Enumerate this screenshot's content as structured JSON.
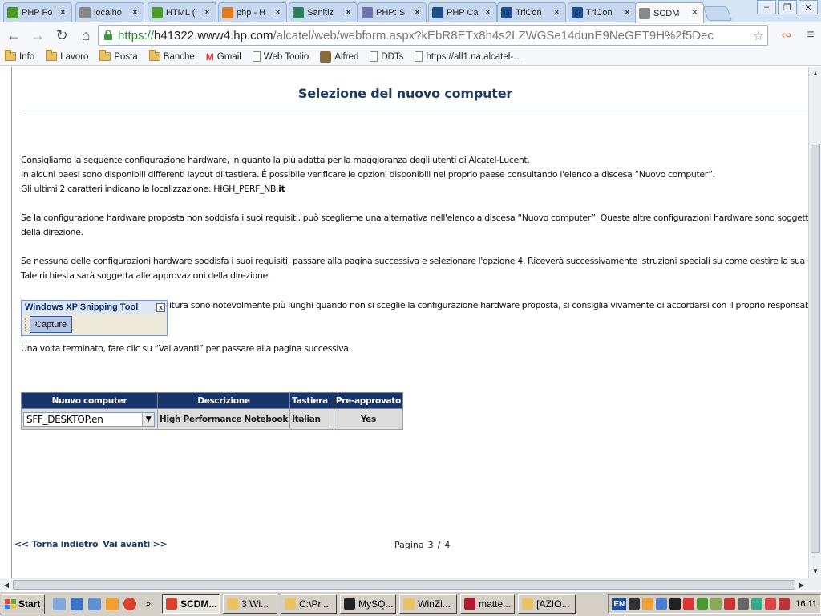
{
  "browser": {
    "tabs": [
      {
        "title": "PHP Fo",
        "favicon": "forum-icon",
        "color": "#4a9a2a",
        "active": false
      },
      {
        "title": "localho",
        "favicon": "page-icon",
        "color": "#888888",
        "active": false
      },
      {
        "title": "HTML (",
        "favicon": "w3-icon",
        "color": "#4a9a2a",
        "active": false
      },
      {
        "title": "php - H",
        "favicon": "stack-icon",
        "color": "#e07b20",
        "active": false
      },
      {
        "title": "Sanitiz",
        "favicon": "plus-icon",
        "color": "#2e7d5b",
        "active": false
      },
      {
        "title": "PHP: S",
        "favicon": "php-icon",
        "color": "#6b73a8",
        "active": false
      },
      {
        "title": "PHP Ca",
        "favicon": "tri-icon",
        "color": "#1e4d8c",
        "active": false
      },
      {
        "title": "TriCon",
        "favicon": "tri-icon",
        "color": "#1e4d8c",
        "active": false
      },
      {
        "title": "TriCon",
        "favicon": "tri-icon",
        "color": "#1e4d8c",
        "active": false
      },
      {
        "title": "SCDM",
        "favicon": "page-icon",
        "color": "#888888",
        "active": true
      }
    ],
    "url": {
      "scheme": "https://",
      "host": "h41322.www4.hp.com",
      "path": "/alcatel/web/webform.aspx?kEbR8ETx8h4s2LZWGSe14dunE9NeGET9H%2f5Dec"
    },
    "bookmarks": [
      {
        "label": "Info",
        "type": "folder"
      },
      {
        "label": "Lavoro",
        "type": "folder"
      },
      {
        "label": "Posta",
        "type": "folder"
      },
      {
        "label": "Banche",
        "type": "folder"
      },
      {
        "label": "Gmail",
        "type": "gmail"
      },
      {
        "label": "Web Toolio",
        "type": "page"
      },
      {
        "label": "Alfred",
        "type": "alfred"
      },
      {
        "label": "DDTs",
        "type": "page"
      },
      {
        "label": "https://all1.na.alcatel-...",
        "type": "page"
      }
    ]
  },
  "page": {
    "title": "Selezione del nuovo computer",
    "para1_line1": "Consigliamo la seguente configurazione hardware, in quanto la più adatta per la maggioranza degli utenti di Alcatel-Lucent.",
    "para1_line2": "In alcuni paesi sono disponibili differenti layout di tastiera. È possibile verificare le opzioni disponibili nel proprio paese consultando l'elenco a discesa “Nuovo computer”.",
    "para1_line3_prefix": "Gli ultimi 2 caratteri indicano la localizzazione: HIGH_PERF_NB.",
    "para1_line3_suffix": "it",
    "para2_line1": "Se la configurazione hardware proposta non soddisfa i suoi requisiti, può sceglierne una alternativa nell'elenco a discesa “Nuovo computer”. Queste altre configurazioni hardware sono soggette alle approvazioni",
    "para2_line2": "della direzione.",
    "para3_line1": "Se nessuna delle configurazioni hardware soddisfa i suoi requisiti, passare alla pagina successiva e selezionare l'opzione 4. Riceverà successivamente istruzioni speciali su come gestire la sua richiesta non standar",
    "para3_line2": "Tale richiesta sarà soggetta alle approvazioni della direzione.",
    "para4_line1": "itura sono notevolmente più lunghi quando non si sceglie la configurazione hardware proposta, si consiglia vivamente di accordarsi con il proprio responsabile prima di inoltr",
    "para5": "Una volta terminato, fare clic su “Vai avanti” per passare alla pagina successiva.",
    "table": {
      "headers": [
        "Nuovo computer",
        "Descrizione",
        "Tastiera",
        "",
        "Pre-approvato"
      ],
      "row": {
        "select_value": "SFF_DESKTOP.en",
        "description": "High Performance Notebook",
        "keyboard": "Italian",
        "extra": "",
        "preapproved": "Yes"
      }
    },
    "nav": {
      "back": "<< Torna indietro",
      "forward": "Vai avanti >>"
    },
    "pagination": {
      "label": "Pagina",
      "current": "3",
      "sep": "/",
      "total": "4"
    }
  },
  "snipping_tool": {
    "title": "Windows XP Snipping Tool",
    "close": "x",
    "button": "Capture"
  },
  "taskbar": {
    "start": "Start",
    "tasks": [
      {
        "label": "SCDM...",
        "color": "#d9412b",
        "pressed": true
      },
      {
        "label": "3 Wi...",
        "color": "#e9c261",
        "pressed": false
      },
      {
        "label": "C:\\Pr...",
        "color": "#e9c261",
        "pressed": false
      },
      {
        "label": "MySQ...",
        "color": "#222222",
        "pressed": false
      },
      {
        "label": "WinZi...",
        "color": "#e9c261",
        "pressed": false
      },
      {
        "label": "matte...",
        "color": "#b01c2e",
        "pressed": false
      },
      {
        "label": "[AZIO...",
        "color": "#e9c261",
        "pressed": false
      }
    ],
    "language": "EN",
    "clock": "16.11"
  }
}
